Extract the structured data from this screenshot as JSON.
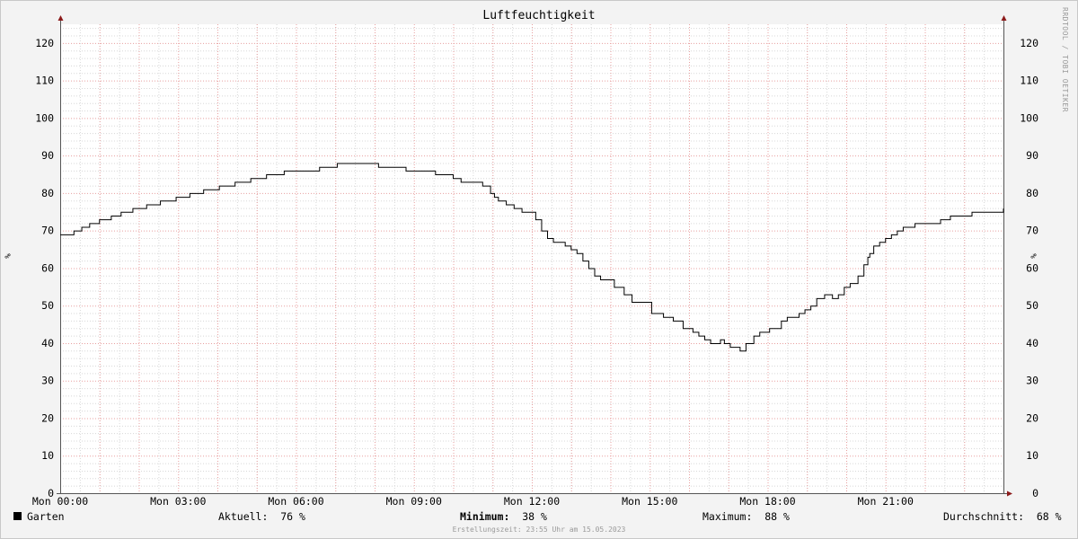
{
  "watermark": "RRDTOOL / TOBI OETIKER",
  "footer": "Erstellungszeit: 23:55 Uhr am 15.05.2023",
  "legend": {
    "series": "Garten",
    "current_label": "Aktuell:",
    "current_value": "76 %",
    "min_label": "Minimum:",
    "min_value": "38 %",
    "max_label": "Maximum:",
    "max_value": "88 %",
    "avg_label": "Durchschnitt:",
    "avg_value": "68 %"
  },
  "colors": {
    "background": "#f3f3f3",
    "canvas": "#ffffff",
    "major_grid": "#e8a0a0",
    "minor_grid": "#d8d8d8",
    "line": "#000000",
    "axis_arrow": "#8b1a1a"
  },
  "chart_data": {
    "type": "line",
    "title": "Luftfeuchtigkeit",
    "ylabel": "%",
    "ylabel_right": "%",
    "ylim": [
      0,
      125
    ],
    "yticks": [
      0,
      10,
      20,
      30,
      40,
      50,
      60,
      70,
      80,
      90,
      100,
      110,
      120
    ],
    "xlim": [
      0,
      24
    ],
    "xticks": [
      0,
      3,
      6,
      9,
      12,
      15,
      18,
      21
    ],
    "xtick_labels": [
      "Mon 00:00",
      "Mon 03:00",
      "Mon 06:00",
      "Mon 09:00",
      "Mon 12:00",
      "Mon 15:00",
      "Mon 18:00",
      "Mon 21:00"
    ],
    "grid": true,
    "legend_position": "bottom",
    "series": [
      {
        "name": "Garten",
        "color": "#000000",
        "x": [
          0.0,
          0.2,
          0.35,
          0.55,
          0.75,
          1.0,
          1.3,
          1.55,
          1.85,
          2.2,
          2.55,
          2.95,
          3.3,
          3.65,
          4.05,
          4.45,
          4.85,
          5.25,
          5.7,
          6.15,
          6.6,
          7.05,
          7.5,
          7.8,
          8.1,
          8.3,
          8.6,
          8.8,
          9.05,
          9.3,
          9.55,
          9.75,
          10.0,
          10.2,
          10.4,
          10.55,
          10.75,
          10.95,
          11.05,
          11.15,
          11.35,
          11.55,
          11.75,
          11.95,
          12.1,
          12.25,
          12.4,
          12.55,
          12.7,
          12.85,
          13.0,
          13.15,
          13.3,
          13.45,
          13.6,
          13.75,
          14.1,
          14.35,
          14.55,
          14.7,
          14.85,
          14.95,
          15.05,
          15.15,
          15.35,
          15.6,
          15.85,
          16.1,
          16.25,
          16.4,
          16.5,
          16.55,
          16.65,
          16.8,
          16.9,
          17.05,
          17.3,
          17.45,
          17.65,
          17.8,
          18.05,
          18.35,
          18.5,
          18.65,
          18.8,
          18.95,
          19.1,
          19.25,
          19.45,
          19.65,
          19.8,
          19.95,
          20.1,
          20.3,
          20.45,
          20.55,
          20.6,
          20.7,
          20.85,
          21.0,
          21.15,
          21.3,
          21.45,
          21.75,
          22.05,
          22.4,
          22.65,
          22.9,
          23.2,
          23.55,
          24.0
        ],
        "values": [
          69,
          69,
          70,
          71,
          72,
          73,
          74,
          75,
          76,
          77,
          78,
          79,
          80,
          81,
          82,
          83,
          84,
          85,
          86,
          86,
          87,
          88,
          88,
          88,
          87,
          87,
          87,
          86,
          86,
          86,
          85,
          85,
          84,
          83,
          83,
          83,
          82,
          80,
          79,
          78,
          77,
          76,
          75,
          75,
          73,
          70,
          68,
          67,
          67,
          66,
          65,
          64,
          62,
          60,
          58,
          57,
          55,
          53,
          51,
          51,
          51,
          51,
          48,
          48,
          47,
          46,
          44,
          43,
          42,
          41,
          41,
          40,
          40,
          41,
          40,
          39,
          38,
          40,
          42,
          43,
          44,
          46,
          47,
          47,
          48,
          49,
          50,
          52,
          53,
          52,
          53,
          55,
          56,
          58,
          61,
          63,
          64,
          66,
          67,
          68,
          69,
          70,
          71,
          72,
          72,
          73,
          74,
          74,
          75,
          75,
          76
        ]
      }
    ]
  }
}
